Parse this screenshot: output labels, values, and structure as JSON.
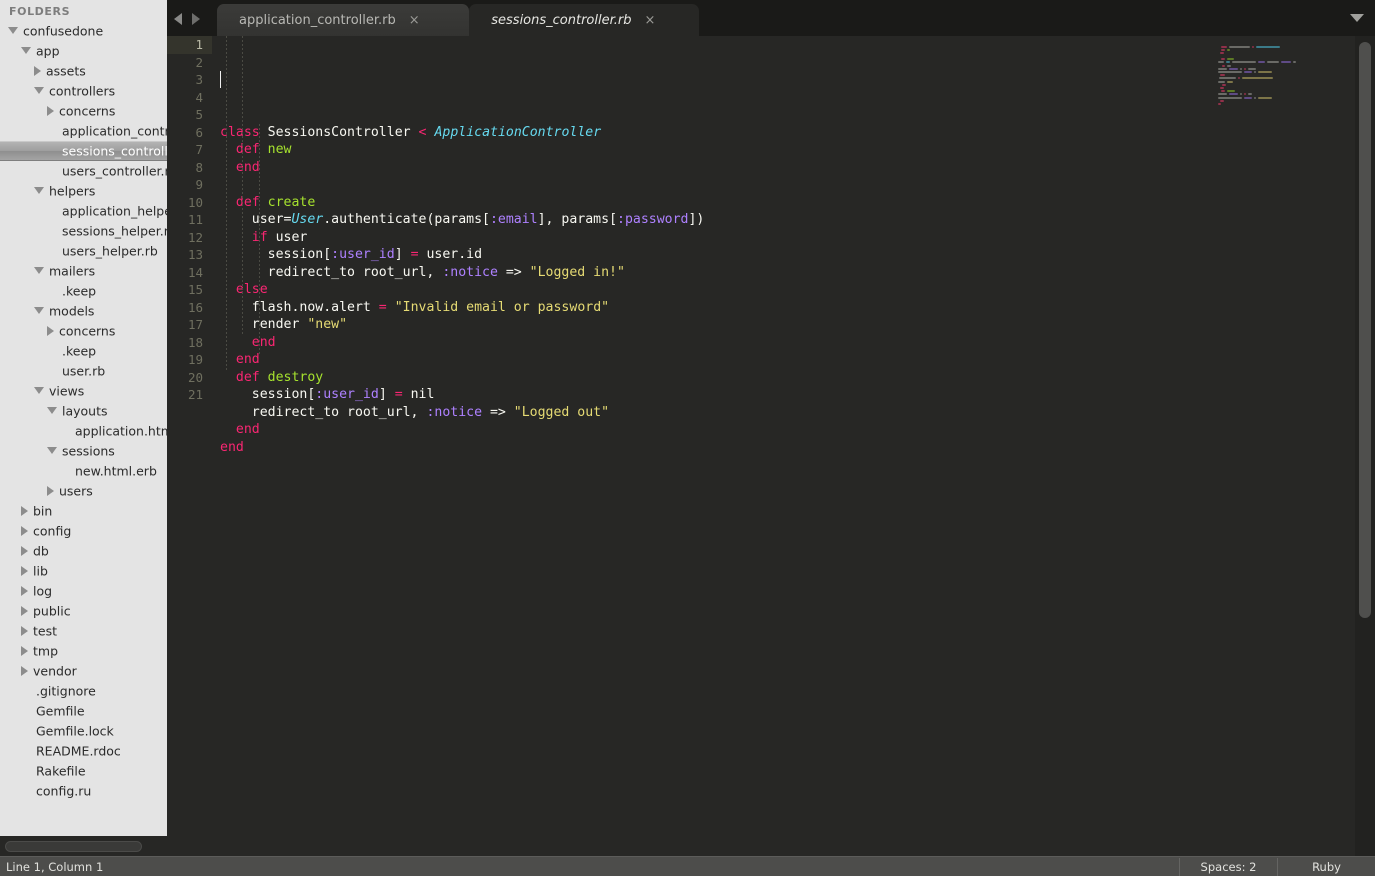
{
  "sidebar": {
    "header": "FOLDERS",
    "scrollbar": "horizontal-scrollbar",
    "tree": [
      {
        "label": "confusedone",
        "depth": 0,
        "kind": "folder-open",
        "selected": false
      },
      {
        "label": "app",
        "depth": 1,
        "kind": "folder-open",
        "selected": false
      },
      {
        "label": "assets",
        "depth": 2,
        "kind": "folder-closed",
        "selected": false
      },
      {
        "label": "controllers",
        "depth": 2,
        "kind": "folder-open",
        "selected": false
      },
      {
        "label": "concerns",
        "depth": 3,
        "kind": "folder-closed",
        "selected": false
      },
      {
        "label": "application_controller.rb",
        "depth": 3,
        "kind": "file",
        "selected": false
      },
      {
        "label": "sessions_controller.rb",
        "depth": 3,
        "kind": "file",
        "selected": true
      },
      {
        "label": "users_controller.rb",
        "depth": 3,
        "kind": "file",
        "selected": false
      },
      {
        "label": "helpers",
        "depth": 2,
        "kind": "folder-open",
        "selected": false
      },
      {
        "label": "application_helper.rb",
        "depth": 3,
        "kind": "file",
        "selected": false
      },
      {
        "label": "sessions_helper.rb",
        "depth": 3,
        "kind": "file",
        "selected": false
      },
      {
        "label": "users_helper.rb",
        "depth": 3,
        "kind": "file",
        "selected": false
      },
      {
        "label": "mailers",
        "depth": 2,
        "kind": "folder-open",
        "selected": false
      },
      {
        "label": ".keep",
        "depth": 3,
        "kind": "file",
        "selected": false
      },
      {
        "label": "models",
        "depth": 2,
        "kind": "folder-open",
        "selected": false
      },
      {
        "label": "concerns",
        "depth": 3,
        "kind": "folder-closed",
        "selected": false
      },
      {
        "label": ".keep",
        "depth": 3,
        "kind": "file",
        "selected": false
      },
      {
        "label": "user.rb",
        "depth": 3,
        "kind": "file",
        "selected": false
      },
      {
        "label": "views",
        "depth": 2,
        "kind": "folder-open",
        "selected": false
      },
      {
        "label": "layouts",
        "depth": 3,
        "kind": "folder-open",
        "selected": false
      },
      {
        "label": "application.html.erb",
        "depth": 4,
        "kind": "file",
        "selected": false
      },
      {
        "label": "sessions",
        "depth": 3,
        "kind": "folder-open",
        "selected": false
      },
      {
        "label": "new.html.erb",
        "depth": 4,
        "kind": "file",
        "selected": false
      },
      {
        "label": "users",
        "depth": 3,
        "kind": "folder-closed",
        "selected": false
      },
      {
        "label": "bin",
        "depth": 1,
        "kind": "folder-closed",
        "selected": false
      },
      {
        "label": "config",
        "depth": 1,
        "kind": "folder-closed",
        "selected": false
      },
      {
        "label": "db",
        "depth": 1,
        "kind": "folder-closed",
        "selected": false
      },
      {
        "label": "lib",
        "depth": 1,
        "kind": "folder-closed",
        "selected": false
      },
      {
        "label": "log",
        "depth": 1,
        "kind": "folder-closed",
        "selected": false
      },
      {
        "label": "public",
        "depth": 1,
        "kind": "folder-closed",
        "selected": false
      },
      {
        "label": "test",
        "depth": 1,
        "kind": "folder-closed",
        "selected": false
      },
      {
        "label": "tmp",
        "depth": 1,
        "kind": "folder-closed",
        "selected": false
      },
      {
        "label": "vendor",
        "depth": 1,
        "kind": "folder-closed",
        "selected": false
      },
      {
        "label": ".gitignore",
        "depth": 1,
        "kind": "file",
        "selected": false
      },
      {
        "label": "Gemfile",
        "depth": 1,
        "kind": "file",
        "selected": false
      },
      {
        "label": "Gemfile.lock",
        "depth": 1,
        "kind": "file",
        "selected": false
      },
      {
        "label": "README.rdoc",
        "depth": 1,
        "kind": "file",
        "selected": false
      },
      {
        "label": "Rakefile",
        "depth": 1,
        "kind": "file",
        "selected": false
      },
      {
        "label": "config.ru",
        "depth": 1,
        "kind": "file",
        "selected": false
      }
    ]
  },
  "tabbar": {
    "nav_prev_icon": "arrow-left-icon",
    "nav_next_icon": "arrow-right-icon",
    "menu_icon": "chevron-down-icon",
    "close_glyph": "×",
    "tabs": [
      {
        "label": "application_controller.rb",
        "active": false
      },
      {
        "label": "sessions_controller.rb",
        "active": true
      }
    ]
  },
  "editor": {
    "active_line": 1,
    "line_numbers": [
      1,
      2,
      3,
      4,
      5,
      6,
      7,
      8,
      9,
      10,
      11,
      12,
      13,
      14,
      15,
      16,
      17,
      18,
      19,
      20,
      21
    ],
    "lines": [
      [
        {
          "t": "class",
          "c": "kw"
        },
        {
          "t": " ",
          "c": "plain"
        },
        {
          "t": "SessionsController",
          "c": "plain"
        },
        {
          "t": " ",
          "c": "plain"
        },
        {
          "t": "<",
          "c": "op"
        },
        {
          "t": " ",
          "c": "plain"
        },
        {
          "t": "ApplicationController",
          "c": "cls"
        }
      ],
      [
        {
          "t": "  ",
          "c": "plain"
        },
        {
          "t": "def",
          "c": "kw"
        },
        {
          "t": " ",
          "c": "plain"
        },
        {
          "t": "new",
          "c": "fn"
        }
      ],
      [
        {
          "t": "  ",
          "c": "plain"
        },
        {
          "t": "end",
          "c": "kw"
        }
      ],
      [],
      [
        {
          "t": "  ",
          "c": "plain"
        },
        {
          "t": "def",
          "c": "kw"
        },
        {
          "t": " ",
          "c": "plain"
        },
        {
          "t": "create",
          "c": "fn"
        }
      ],
      [
        {
          "t": "    user=",
          "c": "plain"
        },
        {
          "t": "User",
          "c": "cls"
        },
        {
          "t": ".authenticate(params[",
          "c": "plain"
        },
        {
          "t": ":email",
          "c": "sym"
        },
        {
          "t": "], params[",
          "c": "plain"
        },
        {
          "t": ":password",
          "c": "sym"
        },
        {
          "t": "])",
          "c": "plain"
        }
      ],
      [
        {
          "t": "    ",
          "c": "plain"
        },
        {
          "t": "if",
          "c": "kw"
        },
        {
          "t": " user",
          "c": "plain"
        }
      ],
      [
        {
          "t": "      session[",
          "c": "plain"
        },
        {
          "t": ":user_id",
          "c": "sym"
        },
        {
          "t": "] ",
          "c": "plain"
        },
        {
          "t": "=",
          "c": "op"
        },
        {
          "t": " user.id",
          "c": "plain"
        }
      ],
      [
        {
          "t": "      redirect_to root_url, ",
          "c": "plain"
        },
        {
          "t": ":notice",
          "c": "sym"
        },
        {
          "t": " => ",
          "c": "plain"
        },
        {
          "t": "\"Logged in!\"",
          "c": "str"
        }
      ],
      [
        {
          "t": "  ",
          "c": "plain"
        },
        {
          "t": "else",
          "c": "kw"
        }
      ],
      [
        {
          "t": "    flash.now.alert ",
          "c": "plain"
        },
        {
          "t": "=",
          "c": "op"
        },
        {
          "t": " ",
          "c": "plain"
        },
        {
          "t": "\"Invalid email or password\"",
          "c": "str"
        }
      ],
      [
        {
          "t": "    render ",
          "c": "plain"
        },
        {
          "t": "\"new\"",
          "c": "str"
        }
      ],
      [
        {
          "t": "    ",
          "c": "plain"
        },
        {
          "t": "end",
          "c": "kw"
        }
      ],
      [
        {
          "t": "  ",
          "c": "plain"
        },
        {
          "t": "end",
          "c": "kw"
        }
      ],
      [
        {
          "t": "  ",
          "c": "plain"
        },
        {
          "t": "def",
          "c": "kw"
        },
        {
          "t": " ",
          "c": "plain"
        },
        {
          "t": "destroy",
          "c": "fn"
        }
      ],
      [
        {
          "t": "    session[",
          "c": "plain"
        },
        {
          "t": ":user_id",
          "c": "sym"
        },
        {
          "t": "] ",
          "c": "plain"
        },
        {
          "t": "=",
          "c": "op"
        },
        {
          "t": " nil",
          "c": "plain"
        }
      ],
      [
        {
          "t": "    redirect_to root_url, ",
          "c": "plain"
        },
        {
          "t": ":notice",
          "c": "sym"
        },
        {
          "t": " => ",
          "c": "plain"
        },
        {
          "t": "\"Logged out\"",
          "c": "str"
        }
      ],
      [
        {
          "t": "  ",
          "c": "plain"
        },
        {
          "t": "end",
          "c": "kw"
        }
      ],
      [
        {
          "t": "end",
          "c": "kw"
        }
      ],
      [],
      []
    ],
    "minimap": "code-minimap",
    "vertical_scrollbar": "editor-vertical-scrollbar"
  },
  "statusbar": {
    "caret_position": "Line 1, Column 1",
    "indentation": "Spaces: 2",
    "syntax": "Ruby"
  },
  "colors": {
    "editor_bg": "#272725",
    "sidebar_bg": "#e4e4e4",
    "keyword": "#f92672",
    "function": "#a6e22e",
    "class": "#66d9ef",
    "string": "#e6db74",
    "symbol": "#ae81ff",
    "text": "#f8f8f2",
    "statusbar_bg": "#4d4d4b"
  }
}
